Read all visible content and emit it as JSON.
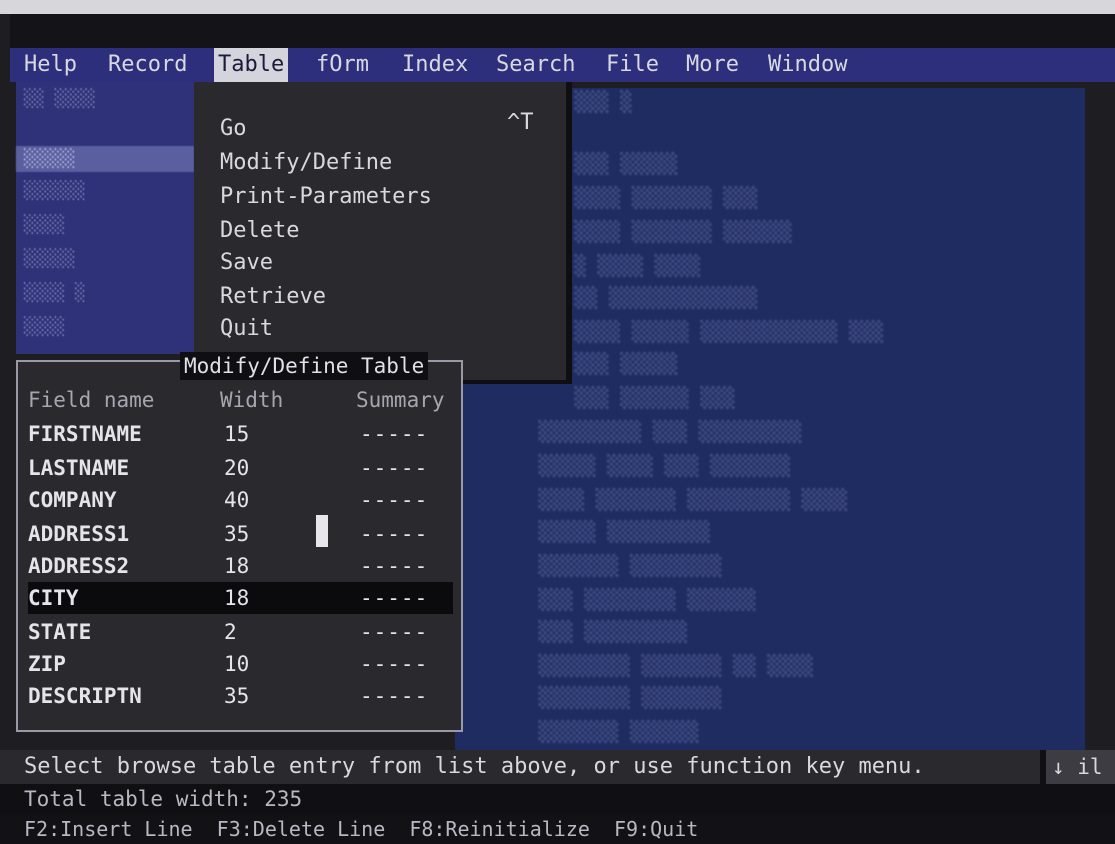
{
  "menu": {
    "items": [
      "Help",
      "Record",
      "Table",
      "fOrm",
      "Index",
      "Search",
      "File",
      "More",
      "Window"
    ],
    "active_index": 2
  },
  "dropdown": {
    "items": [
      "Go",
      "Modify/Define",
      "Print-Parameters",
      "Delete",
      "Save",
      "Retrieve",
      "Quit"
    ],
    "go_shortcut": "^T"
  },
  "modify_define_table": {
    "title": "Modify/Define Table",
    "headers": [
      "Field name",
      "Width",
      "Summary"
    ],
    "rows": [
      {
        "field": "FIRSTNAME",
        "width": "15",
        "summary": "-----"
      },
      {
        "field": "LASTNAME",
        "width": "20",
        "summary": "-----"
      },
      {
        "field": "COMPANY",
        "width": "40",
        "summary": "-----"
      },
      {
        "field": "ADDRESS1",
        "width": "35",
        "summary": "-----"
      },
      {
        "field": "ADDRESS2",
        "width": "18",
        "summary": "-----"
      },
      {
        "field": "CITY",
        "width": "18",
        "summary": "-----"
      },
      {
        "field": "STATE",
        "width": "2",
        "summary": "-----"
      },
      {
        "field": "ZIP",
        "width": "10",
        "summary": "-----"
      },
      {
        "field": "DESCRIPTN",
        "width": "35",
        "summary": "-----"
      }
    ],
    "selected_index": 5
  },
  "status": {
    "message": "Select browse table entry from list above, or use function key menu.",
    "right_indicator": "↓ il"
  },
  "info": {
    "total_width": "Total table width: 235"
  },
  "function_keys": "F2:Insert Line  F3:Delete Line  F8:Reinitialize  F9:Quit",
  "colors": {
    "menubar": "#2d2f7c",
    "panel_blue": "#1f2c62",
    "dialog_bg": "#2a2a2e"
  }
}
